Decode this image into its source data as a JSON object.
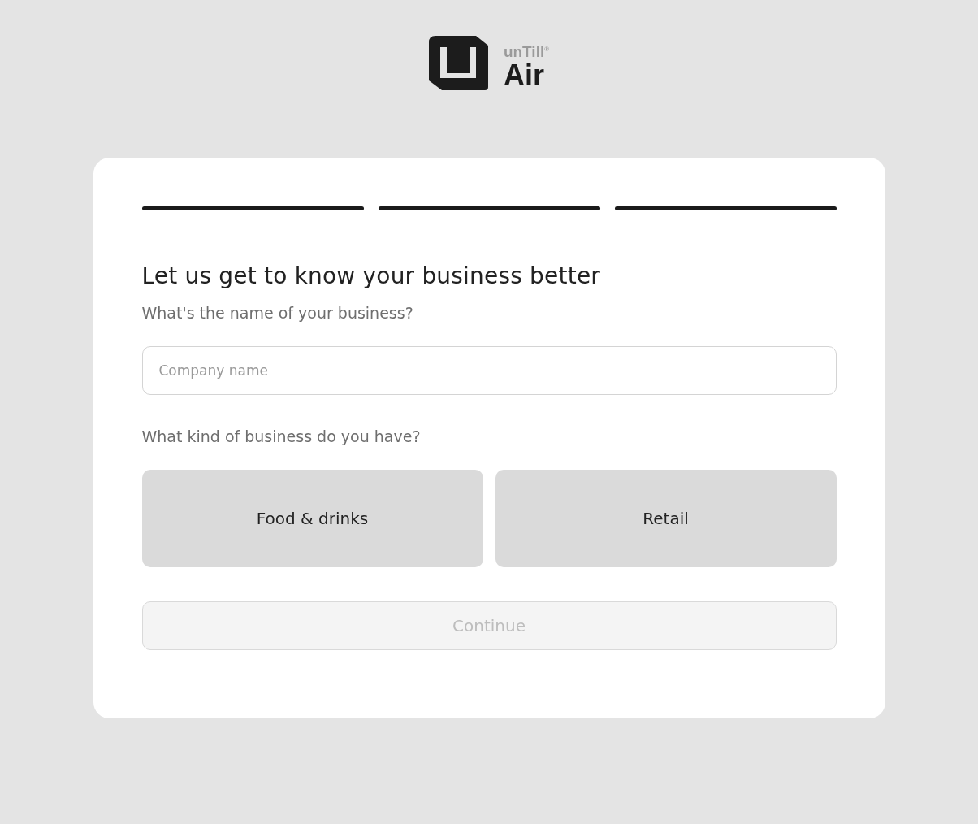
{
  "logo": {
    "brand": "unTill$^{®}$",
    "product": "Air"
  },
  "steps": [
    {
      "done": true
    },
    {
      "done": true
    },
    {
      "done": true
    }
  ],
  "heading": "Let us get to know your business better",
  "name_question": "What's the name of your business?",
  "company_field": {
    "placeholder": "Company name"
  },
  "kind_question": "What kind of business do you have?",
  "business_types": [
    {
      "label": "Food & drinks",
      "selected": false
    },
    {
      "label": "Retail",
      "selected": false
    }
  ],
  "continue_button": {
    "label": "Continue",
    "disabled": true
  }
}
